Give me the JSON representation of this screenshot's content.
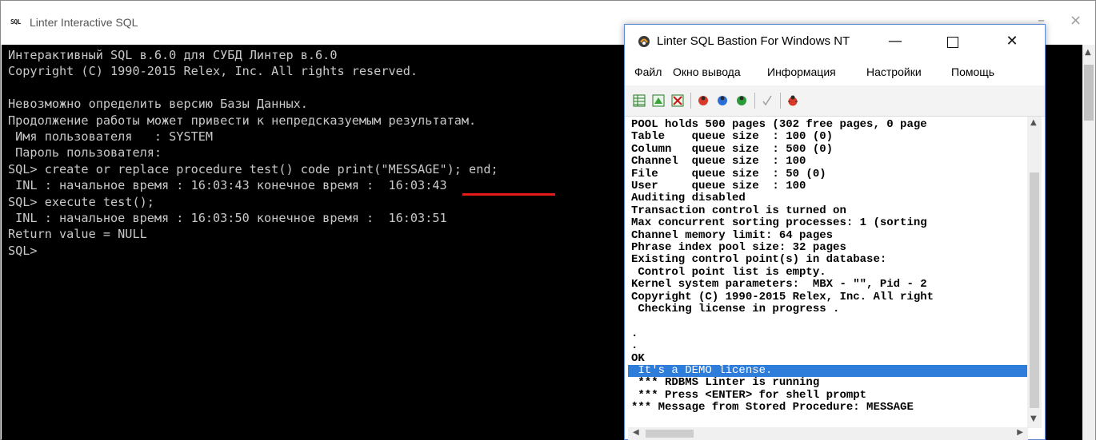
{
  "console": {
    "title": "Linter Interactive SQL",
    "icon": "sql-badge-icon",
    "icon_text": "SQL",
    "controls": {
      "minimize": "–",
      "maximize": "☐",
      "close": "×"
    },
    "lines": [
      "Интерактивный SQL в.6.0 для СУБД Линтер в.6.0",
      "Copyright (C) 1990-2015 Relex, Inc. All rights reserved.",
      "",
      "Невозможно определить версию Базы Данных.",
      "Продолжение работы может привести к непредсказуемым результатам.",
      " Имя пользователя   : SYSTEM",
      " Пароль пользователя:",
      "SQL> create or replace procedure test() code print(\"MESSAGE\"); end;",
      " INL : начальное время : 16:03:43 конечное время :  16:03:43",
      "SQL> execute test();",
      " INL : начальное время : 16:03:50 конечное время :  16:03:51",
      "Return value = NULL",
      "SQL>"
    ]
  },
  "bastion": {
    "title": "Linter SQL Bastion For Windows NT",
    "icon": "bastion-app-icon",
    "controls": {
      "minimize": "—",
      "maximize": "☐",
      "close": "✕"
    },
    "menu": [
      "Файл",
      "Окно вывода",
      "Информация",
      "Настройки",
      "Помощь"
    ],
    "toolbar": [
      "grid-icon",
      "split-icon",
      "disconnect-icon",
      "bug-red-icon",
      "bug-blue-icon",
      "bug-green-icon",
      "check-icon",
      "bug-run-icon"
    ],
    "output_lines": [
      "POOL holds 500 pages (302 free pages, 0 page",
      "Table    queue size  : 100 (0)",
      "Column   queue size  : 500 (0)",
      "Channel  queue size  : 100",
      "File     queue size  : 50 (0)",
      "User     queue size  : 100",
      "Auditing disabled",
      "Transaction control is turned on",
      "Max concurrent sorting processes: 1 (sorting",
      "Channel memory limit: 64 pages",
      "Phrase index pool size: 32 pages",
      "Existing control point(s) in database:",
      " Control point list is empty.",
      "Kernel system parameters:  MBX - \"\", Pid - 2",
      "Copyright (C) 1990-2015 Relex, Inc. All right",
      " Checking license in progress .",
      "",
      ".",
      ".",
      "OK",
      " It's a DEMO license.",
      " *** RDBMS Linter is running",
      " *** Press <ENTER> for shell prompt",
      "*** Message from Stored Procedure: MESSAGE"
    ],
    "highlighted_line_index": 20,
    "highlight_color": "#2e7ddb"
  },
  "annotation_color": "#e31b1b"
}
